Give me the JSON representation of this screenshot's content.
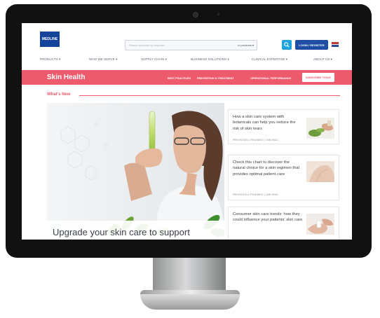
{
  "logo": {
    "text": "MEDLINE"
  },
  "search": {
    "placeholder": "Search products by keyword",
    "scope": "in products ▾"
  },
  "header": {
    "login_label": "LOGIN / REGISTER",
    "flag_label": "US"
  },
  "nav": {
    "items": [
      "PRODUCTS ▾",
      "WHO WE SERVE ▾",
      "SUPPLY CHAIN ▾",
      "BUSINESS SOLUTIONS ▾",
      "CLINICAL EXPERTISE ▾",
      "ABOUT US ▾"
    ]
  },
  "banner": {
    "title": "Skin Health",
    "links": [
      "BEST PRACTICES",
      "PREVENTION & TREATMENT",
      "OPERATIONAL PERFORMANCE"
    ],
    "subscribe_label": "SUBSCRIBE TODAY"
  },
  "section": {
    "title": "What's New"
  },
  "hero": {
    "caption": "Upgrade your skin care to support"
  },
  "cards": [
    {
      "title": "How a skin care system with botanicals can help you reduce the risk of skin tears",
      "meta": "PREVENTION & TREATMENT | 2 MIN READ"
    },
    {
      "title": "Check this chart to discover the natural choice for a skin regimen that provides optimal patient care",
      "meta": "PREVENTION & TREATMENT | 1 MIN READ"
    },
    {
      "title": "Consumer skin care trends: how they could influence your patients' skin care",
      "meta": ""
    }
  ],
  "colors": {
    "accent": "#ec5a6c",
    "brand": "#15449a",
    "search_button": "#1fa3dc"
  },
  "icons": {
    "search": "search-icon",
    "camera": "camera-icon"
  }
}
